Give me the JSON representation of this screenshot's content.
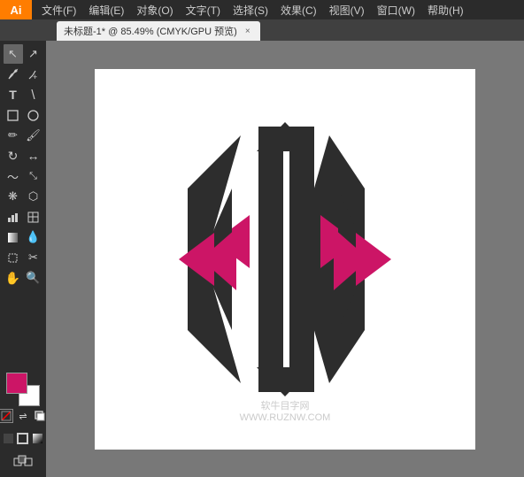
{
  "app": {
    "logo": "Ai",
    "menu": [
      "文件(F)",
      "编辑(E)",
      "对象(O)",
      "文字(T)",
      "选择(S)",
      "效果(C)",
      "视图(V)",
      "窗口(W)",
      "帮助(H)"
    ]
  },
  "tab": {
    "title": "未标题-1* @ 85.49% (CMYK/GPU 预览)",
    "close": "×"
  },
  "watermark": {
    "line1": "软牛目字网",
    "line2": "WWW.RUZNW.COM"
  },
  "toolbar": {
    "tools": [
      {
        "name": "select-tool",
        "icon": "↖"
      },
      {
        "name": "direct-select-tool",
        "icon": "↗"
      },
      {
        "name": "pen-tool",
        "icon": "✒"
      },
      {
        "name": "add-anchor-tool",
        "icon": "+"
      },
      {
        "name": "type-tool",
        "icon": "T"
      },
      {
        "name": "line-tool",
        "icon": "/"
      },
      {
        "name": "rectangle-tool",
        "icon": "▭"
      },
      {
        "name": "ellipse-tool",
        "icon": "◯"
      },
      {
        "name": "pencil-tool",
        "icon": "✏"
      },
      {
        "name": "rotate-tool",
        "icon": "↻"
      },
      {
        "name": "scale-tool",
        "icon": "⤢"
      },
      {
        "name": "blend-tool",
        "icon": "⬡"
      },
      {
        "name": "gradient-tool",
        "icon": "▣"
      },
      {
        "name": "mesh-tool",
        "icon": "⊞"
      },
      {
        "name": "eyedropper-tool",
        "icon": "🔍"
      },
      {
        "name": "warp-tool",
        "icon": "~"
      },
      {
        "name": "symbol-tool",
        "icon": "❋"
      },
      {
        "name": "column-graph-tool",
        "icon": "📊"
      },
      {
        "name": "artboard-tool",
        "icon": "⬜"
      },
      {
        "name": "slice-tool",
        "icon": "✂"
      },
      {
        "name": "hand-tool",
        "icon": "✋"
      },
      {
        "name": "zoom-tool",
        "icon": "🔍"
      }
    ]
  },
  "colors": {
    "foreground": "#CC1566",
    "background": "#FFFFFF"
  }
}
